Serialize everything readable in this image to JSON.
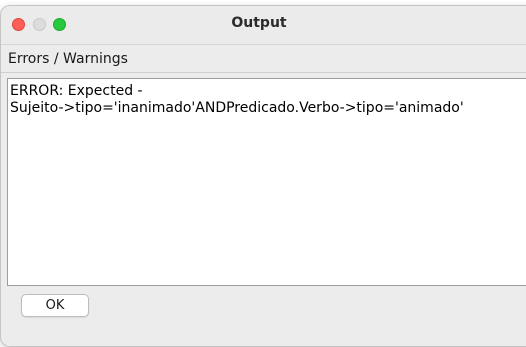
{
  "window": {
    "title": "Output"
  },
  "section": {
    "label": "Errors / Warnings"
  },
  "output": {
    "lines": [
      "ERROR: Expected -",
      "Sujeito->tipo='inanimado'ANDPredicado.Verbo->tipo='animado'"
    ]
  },
  "buttons": {
    "ok_label": "OK"
  },
  "colors": {
    "close": "#fe5f57",
    "minimize": "#dcdcdc",
    "zoom": "#28c840",
    "window_bg": "#ececec"
  },
  "icons": {
    "close": "close-traffic-light-icon",
    "minimize": "minimize-traffic-light-icon",
    "zoom": "zoom-traffic-light-icon"
  }
}
